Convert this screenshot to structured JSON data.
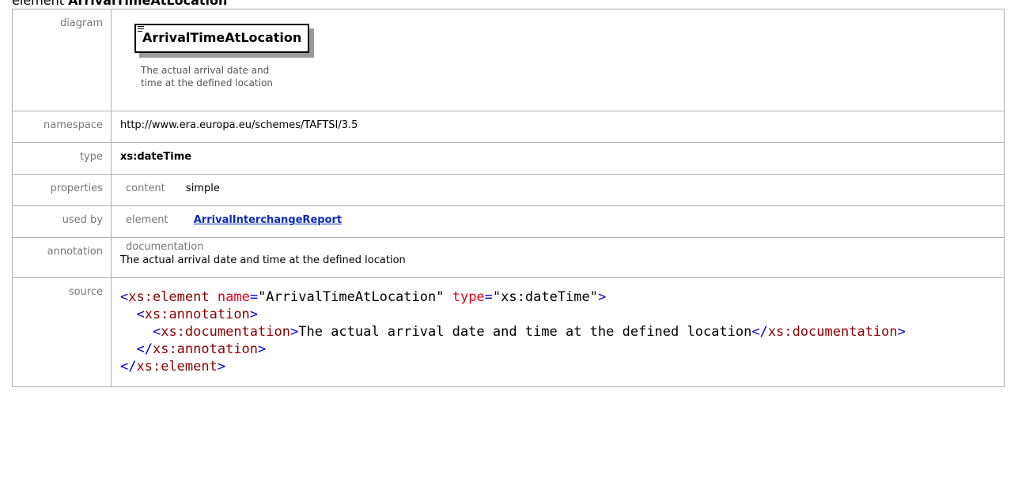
{
  "heading": {
    "kind": "element",
    "name": "ArrivalTimeAtLocation"
  },
  "labels": {
    "diagram": "diagram",
    "namespace": "namespace",
    "type": "type",
    "properties": "properties",
    "used_by": "used by",
    "annotation": "annotation",
    "source": "source"
  },
  "diagram": {
    "element_name": "ArrivalTimeAtLocation",
    "doc_line1": "The actual arrival date and",
    "doc_line2": "time at the defined location"
  },
  "namespace": "http://www.era.europa.eu/schemes/TAFTSI/3.5",
  "type": "xs:dateTime",
  "properties": {
    "key": "content",
    "value": "simple"
  },
  "used_by": {
    "kind": "element",
    "link": "ArrivalInterchangeReport"
  },
  "annotation": {
    "key": "documentation",
    "text": "The actual arrival date and time at the defined location"
  },
  "source": {
    "line1": {
      "open": "<",
      "tag": "xs:element",
      "attr1": "name",
      "eq1": "=",
      "val1": "\"ArrivalTimeAtLocation\"",
      "attr2": "type",
      "eq2": "=",
      "val2": "\"xs:dateTime\"",
      "close": ">"
    },
    "line2": {
      "open": "<",
      "tag": "xs:annotation",
      "close": ">"
    },
    "line3": {
      "open": "<",
      "tag": "xs:documentation",
      "close": ">",
      "text": "The actual arrival date and time at the defined location",
      "end_open": "</",
      "end_tag": "xs:documentation",
      "end_close": ">"
    },
    "line4": {
      "open": "</",
      "tag": "xs:annotation",
      "close": ">"
    },
    "line5": {
      "open": "</",
      "tag": "xs:element",
      "close": ">"
    }
  }
}
